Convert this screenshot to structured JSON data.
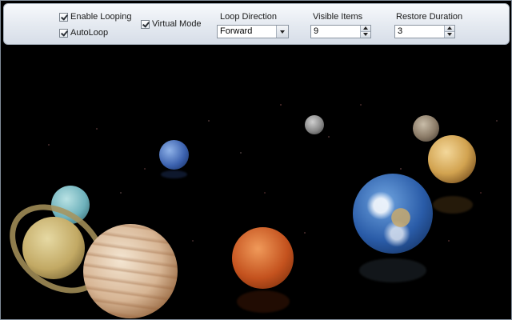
{
  "options": {
    "enable_looping": {
      "label": "Enable Looping",
      "checked": true
    },
    "auto_loop": {
      "label": "AutoLoop",
      "checked": true
    },
    "virtual_mode": {
      "label": "Virtual Mode",
      "checked": true
    }
  },
  "loop_direction": {
    "label": "Loop Direction",
    "value": "Forward"
  },
  "visible_items": {
    "label": "Visible Items",
    "value": "9"
  },
  "restore_duration": {
    "label": "Restore Duration",
    "value": "3"
  },
  "colors": {
    "background": "#000000",
    "toolbar": "#e4e9f0"
  },
  "planets": [
    "saturn",
    "uranus",
    "jupiter",
    "neptune",
    "mars",
    "moon",
    "earth",
    "mercury",
    "venus"
  ]
}
